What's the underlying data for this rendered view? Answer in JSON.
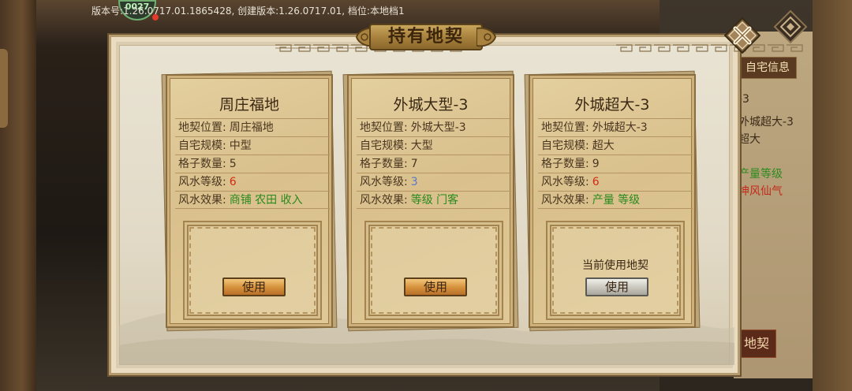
{
  "version_info": "版本号:1.26.0717.01.1865428, 创建版本:1.26.0717.01, 档位:本地档1",
  "avatar_badge": "0027",
  "dialog": {
    "title": "持有地契"
  },
  "background": {
    "home_info_button": "自宅信息",
    "lines": [
      "-3",
      "外城超大-3",
      "超大",
      "产量等级",
      "坤风仙气"
    ],
    "bottom_button": "地契"
  },
  "cards": [
    {
      "title": "周庄福地",
      "rows": [
        {
          "label": "地契位置:",
          "value": "周庄福地"
        },
        {
          "label": "自宅规模:",
          "value": "中型"
        },
        {
          "label": "格子数量:",
          "value": "5"
        },
        {
          "label": "风水等级:",
          "value": "6"
        },
        {
          "label": "风水效果:",
          "value": "商铺 农田 收入"
        }
      ],
      "status": "",
      "button": "使用"
    },
    {
      "title": "外城大型-3",
      "rows": [
        {
          "label": "地契位置:",
          "value": "外城大型-3"
        },
        {
          "label": "自宅规模:",
          "value": "大型"
        },
        {
          "label": "格子数量:",
          "value": "7"
        },
        {
          "label": "风水等级:",
          "value": "3"
        },
        {
          "label": "风水效果:",
          "value": "等级 门客"
        }
      ],
      "status": "",
      "button": "使用"
    },
    {
      "title": "外城超大-3",
      "rows": [
        {
          "label": "地契位置:",
          "value": "外城超大-3"
        },
        {
          "label": "自宅规模:",
          "value": "超大"
        },
        {
          "label": "格子数量:",
          "value": "9"
        },
        {
          "label": "风水等级:",
          "value": "6"
        },
        {
          "label": "风水效果:",
          "value": "产量 等级"
        }
      ],
      "status": "当前使用地契",
      "button": "使用"
    }
  ],
  "colors": {
    "fengshui_high": "#d22a14",
    "fengshui_low": "#5a78c8",
    "effect": "#2a8a1e",
    "button_active": "#d48f3a",
    "button_current": "#c8c6bd"
  },
  "icons": [
    "close-icon",
    "diamond-menu-icon"
  ]
}
